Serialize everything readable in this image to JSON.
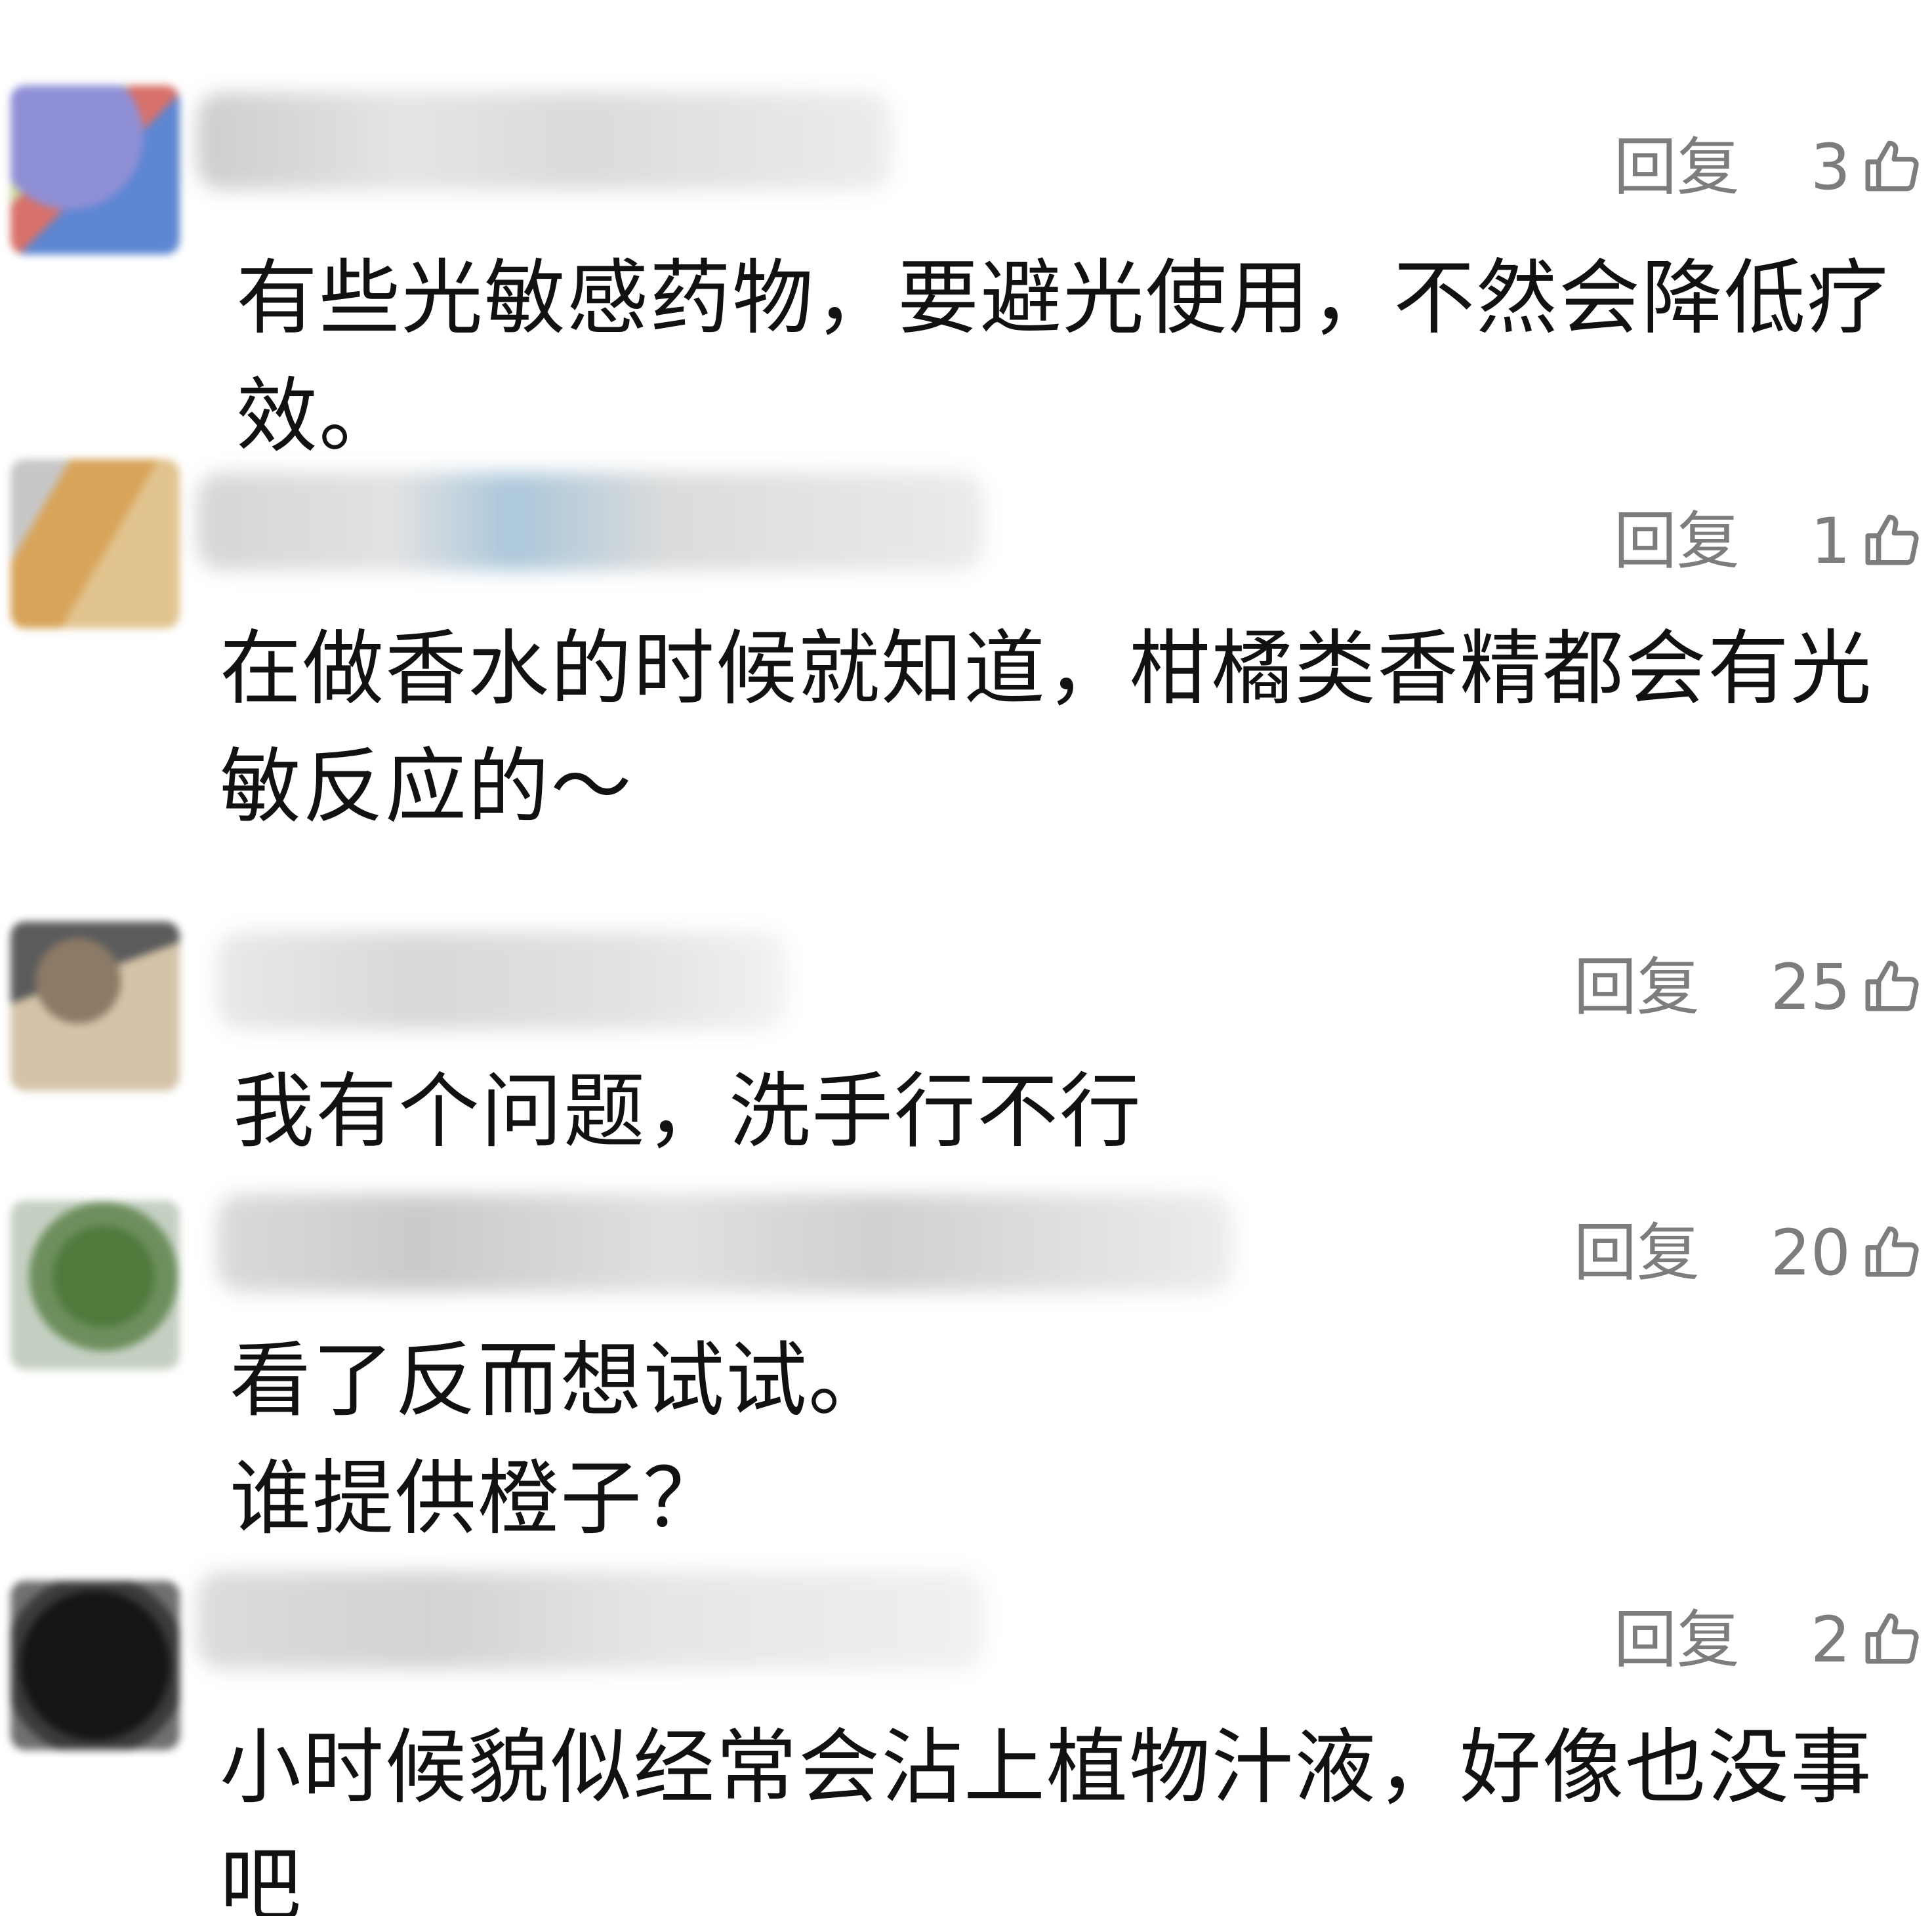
{
  "comments": [
    {
      "reply_label": "回复",
      "likes": "3",
      "text": "有些光敏感药物，要避光使用，不然会降低疗效。",
      "avatar_colors": [
        "#8f8fd6",
        "#c9d39b",
        "#5d86d3",
        "#d8716a"
      ],
      "username_blurred": true
    },
    {
      "reply_label": "回复",
      "likes": "1",
      "text": "在做香水的时候就知道，柑橘类香精都会有光敏反应的～",
      "avatar_colors": [
        "#d8a45a",
        "#c7c7c7",
        "#8fb5cf"
      ],
      "username_blurred": true
    },
    {
      "reply_label": "回复",
      "likes": "25",
      "text": "我有个问题，洗手行不行",
      "avatar_colors": [
        "#5b5b5b",
        "#d4c3a8",
        "#8c7a66"
      ],
      "username_blurred": true
    },
    {
      "reply_label": "回复",
      "likes": "20",
      "text": "看了反而想试试。\n谁提供橙子？",
      "avatar_colors": [
        "#4f7a3c",
        "#c5d0c2",
        "#6d8f5d"
      ],
      "username_blurred": true
    },
    {
      "reply_label": "回复",
      "likes": "2",
      "text": "小时候貌似经常会沾上植物汁液，好像也没事吧",
      "avatar_colors": [
        "#151515",
        "#3b3b3b",
        "#707070"
      ],
      "username_blurred": true
    }
  ],
  "icons": {
    "like": "thumbs-up-outline-icon"
  },
  "colors": {
    "background": "#ffffff",
    "text": "#111111",
    "meta": "#7d7d7d"
  }
}
